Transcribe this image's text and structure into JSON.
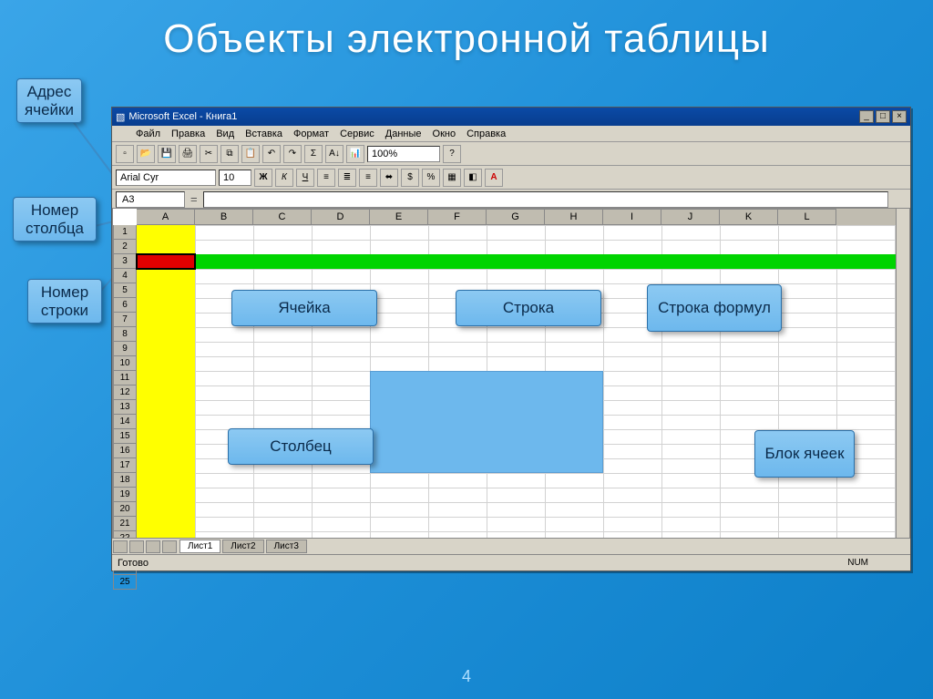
{
  "title": "Объекты электронной таблицы",
  "page_number": "4",
  "excel": {
    "title": "Microsoft Excel - Книга1",
    "menu": [
      "Файл",
      "Правка",
      "Вид",
      "Вставка",
      "Формат",
      "Сервис",
      "Данные",
      "Окно",
      "Справка"
    ],
    "font_name": "Arial Cyr",
    "font_size": "10",
    "zoom": "100%",
    "name_box": "A3",
    "columns": [
      "A",
      "B",
      "C",
      "D",
      "E",
      "F",
      "G",
      "H",
      "I",
      "J",
      "K",
      "L"
    ],
    "rows_count": 25,
    "sheet_tabs": [
      "Лист1",
      "Лист2",
      "Лист3"
    ],
    "status": "Готово",
    "num_indicator": "NUM",
    "highlight_column": "A",
    "highlight_row": 3,
    "active_cell": "A3",
    "selection_block": {
      "left_col": "E",
      "top_row": 11,
      "right_col": "H",
      "bottom_row": 17
    }
  },
  "callouts": {
    "address": "Адрес ячейки",
    "col_num": "Номер столбца",
    "row_num": "Номер строки",
    "cell": "Ячейка",
    "row": "Строка",
    "formula_bar": "Строка формул",
    "column": "Столбец",
    "block": "Блок ячеек"
  }
}
